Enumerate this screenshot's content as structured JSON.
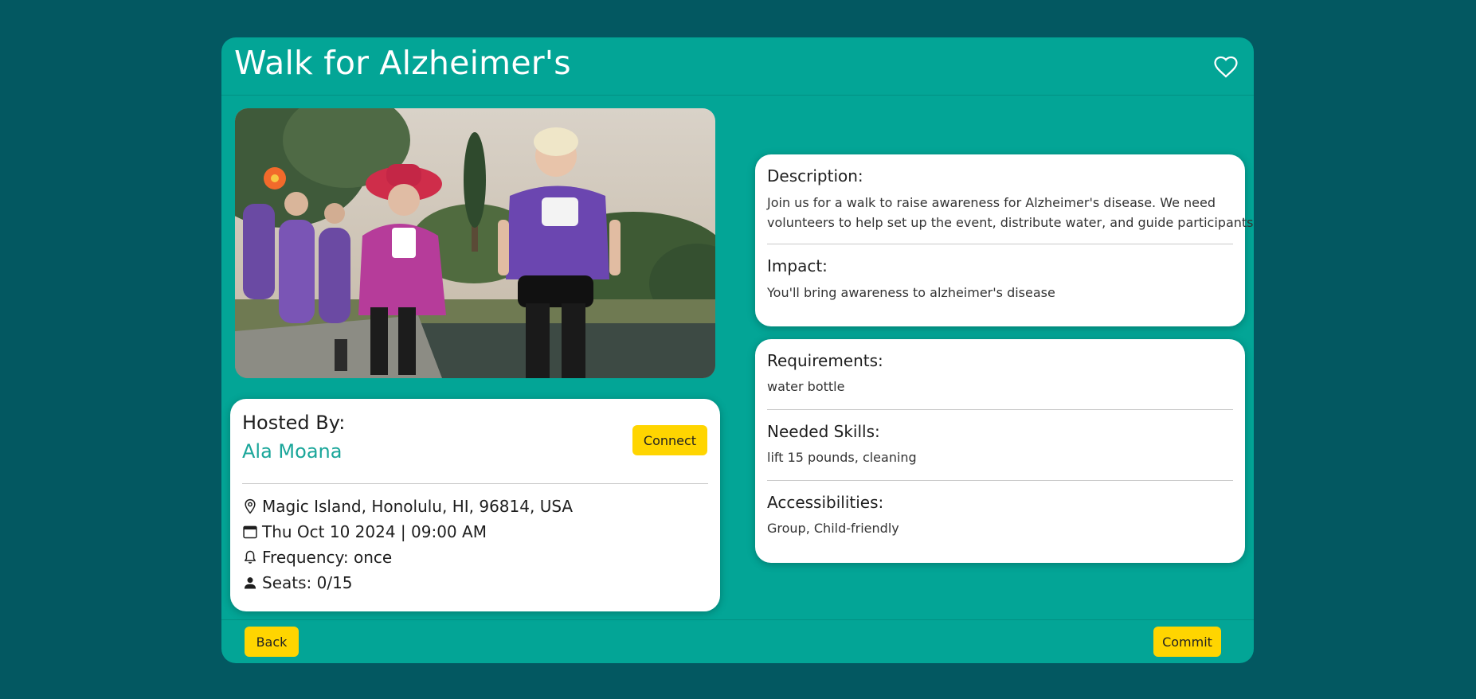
{
  "event": {
    "title": "Walk for Alzheimer's",
    "image_alt": "Group of women in purple shirts walking outdoors"
  },
  "host": {
    "label": "Hosted By:",
    "name": "Ala Moana",
    "connect_label": "Connect"
  },
  "details": {
    "location": "Magic Island, Honolulu, HI, 96814, USA",
    "datetime": "Thu Oct 10 2024 | 09:00 AM",
    "frequency": "Frequency: once",
    "seats": "Seats: 0/15"
  },
  "description": {
    "label": "Description:",
    "line1": "Join us for a walk to raise awareness for Alzheimer's disease. We need",
    "line2": "volunteers to help set up the event, distribute water, and guide participants."
  },
  "impact": {
    "label": "Impact:",
    "text": "You'll bring awareness to alzheimer's disease"
  },
  "requirements": {
    "label": "Requirements:",
    "text": "water bottle"
  },
  "skills": {
    "label": "Needed Skills:",
    "text": "lift 15 pounds, cleaning"
  },
  "accessibilities": {
    "label": "Accessibilities:",
    "text": "Group, Child-friendly"
  },
  "footer": {
    "back_label": "Back",
    "commit_label": "Commit"
  },
  "colors": {
    "page_bg": "#035861",
    "modal_bg": "#03a596",
    "accent_yellow": "#ffd500",
    "host_name": "#1aa69a"
  },
  "icons": [
    "heart-icon",
    "location-pin-icon",
    "calendar-icon",
    "bell-icon",
    "person-icon"
  ]
}
